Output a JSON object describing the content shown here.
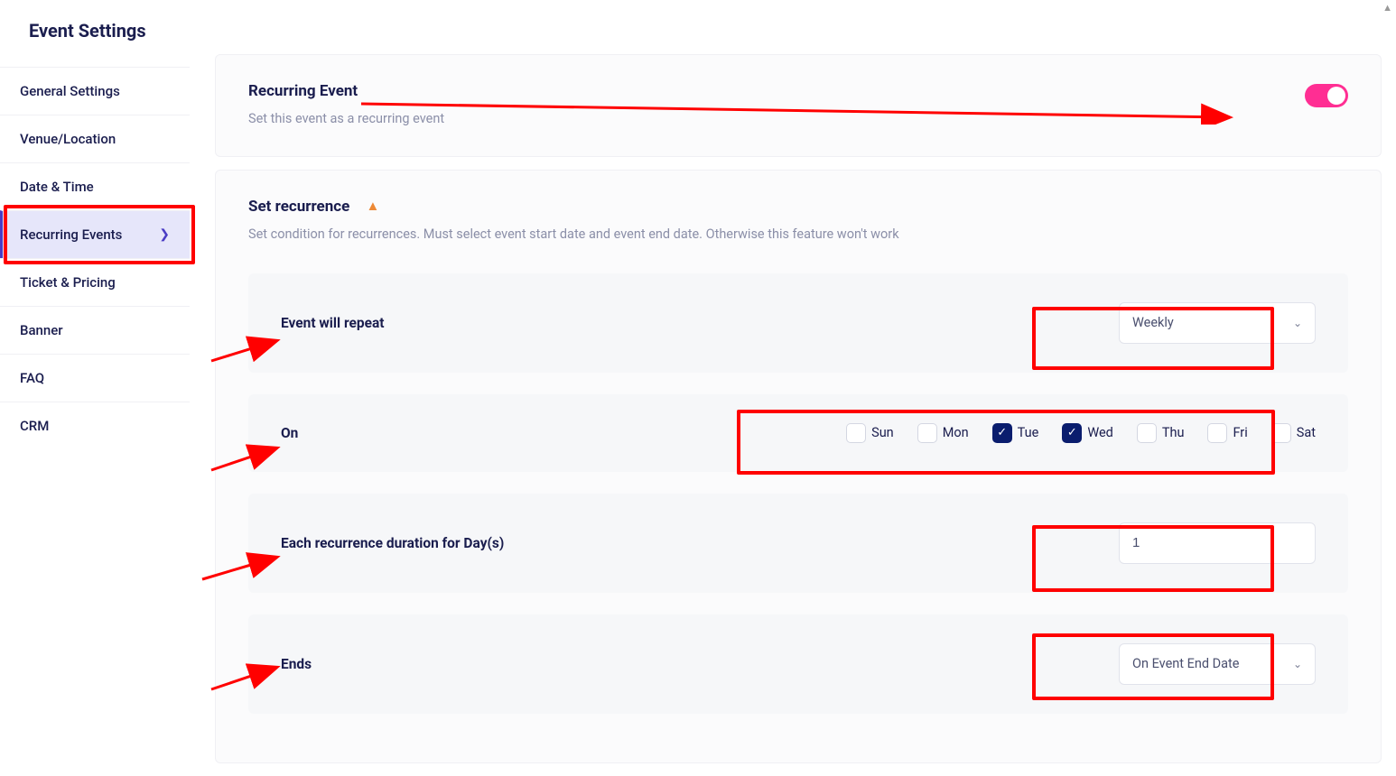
{
  "page_title": "Event Settings",
  "sidebar": {
    "items": [
      {
        "label": "General Settings"
      },
      {
        "label": "Venue/Location"
      },
      {
        "label": "Date & Time"
      },
      {
        "label": "Recurring Events",
        "active": true
      },
      {
        "label": "Ticket & Pricing"
      },
      {
        "label": "Banner"
      },
      {
        "label": "FAQ"
      },
      {
        "label": "CRM"
      }
    ]
  },
  "recurring_toggle": {
    "title": "Recurring Event",
    "desc": "Set this event as a recurring event",
    "enabled": true
  },
  "recurrence": {
    "title": "Set recurrence",
    "desc": "Set condition for recurrences. Must select event start date and event end date. Otherwise this feature won't work",
    "repeat": {
      "label": "Event will repeat",
      "value": "Weekly"
    },
    "on": {
      "label": "On",
      "days": [
        {
          "label": "Sun",
          "checked": false
        },
        {
          "label": "Mon",
          "checked": false
        },
        {
          "label": "Tue",
          "checked": true
        },
        {
          "label": "Wed",
          "checked": true
        },
        {
          "label": "Thu",
          "checked": false
        },
        {
          "label": "Fri",
          "checked": false
        },
        {
          "label": "Sat",
          "checked": false
        }
      ]
    },
    "duration": {
      "label": "Each recurrence duration for Day(s)",
      "value": "1"
    },
    "ends": {
      "label": "Ends",
      "value": "On Event End Date"
    }
  }
}
